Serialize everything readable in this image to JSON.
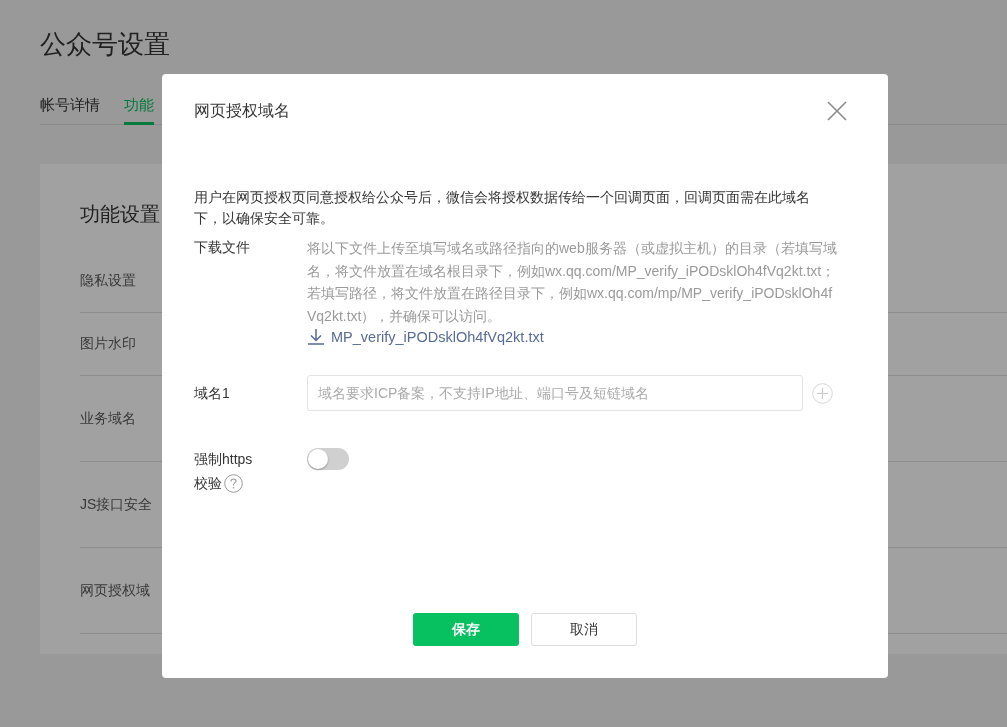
{
  "page": {
    "title": "公众号设置",
    "tabs": [
      {
        "label": "帐号详情",
        "selected": false
      },
      {
        "label": "功能",
        "selected": true
      }
    ],
    "card": {
      "heading": "功能设置",
      "rows": [
        {
          "label": "隐私设置"
        },
        {
          "label": "图片水印"
        },
        {
          "label": "业务域名"
        },
        {
          "label": "JS接口安全"
        },
        {
          "label": "网页授权域"
        }
      ]
    }
  },
  "dialog": {
    "title": "网页授权域名",
    "description": "用户在网页授权页同意授权给公众号后，微信会将授权数据传给一个回调页面，回调页面需在此域名下，以确保安全可靠。",
    "download": {
      "label": "下载文件",
      "instructions": "将以下文件上传至填写域名或路径指向的web服务器（或虚拟主机）的目录（若填写域名，将文件放置在域名根目录下，例如wx.qq.com/MP_verify_iPODsklOh4fVq2kt.txt；若填写路径，将文件放置在路径目录下，例如wx.qq.com/mp/MP_verify_iPODsklOh4fVq2kt.txt），并确保可以访问。",
      "file_link": "MP_verify_iPODsklOh4fVq2kt.txt"
    },
    "domain": {
      "label": "域名1",
      "placeholder": "域名要求ICP备案，不支持IP地址、端口号及短链域名"
    },
    "https": {
      "label_lines": [
        "强制https",
        "校验"
      ],
      "on": false
    },
    "buttons": [
      {
        "label": "保存",
        "kind": "primary"
      },
      {
        "label": "取消",
        "kind": "default"
      }
    ]
  }
}
